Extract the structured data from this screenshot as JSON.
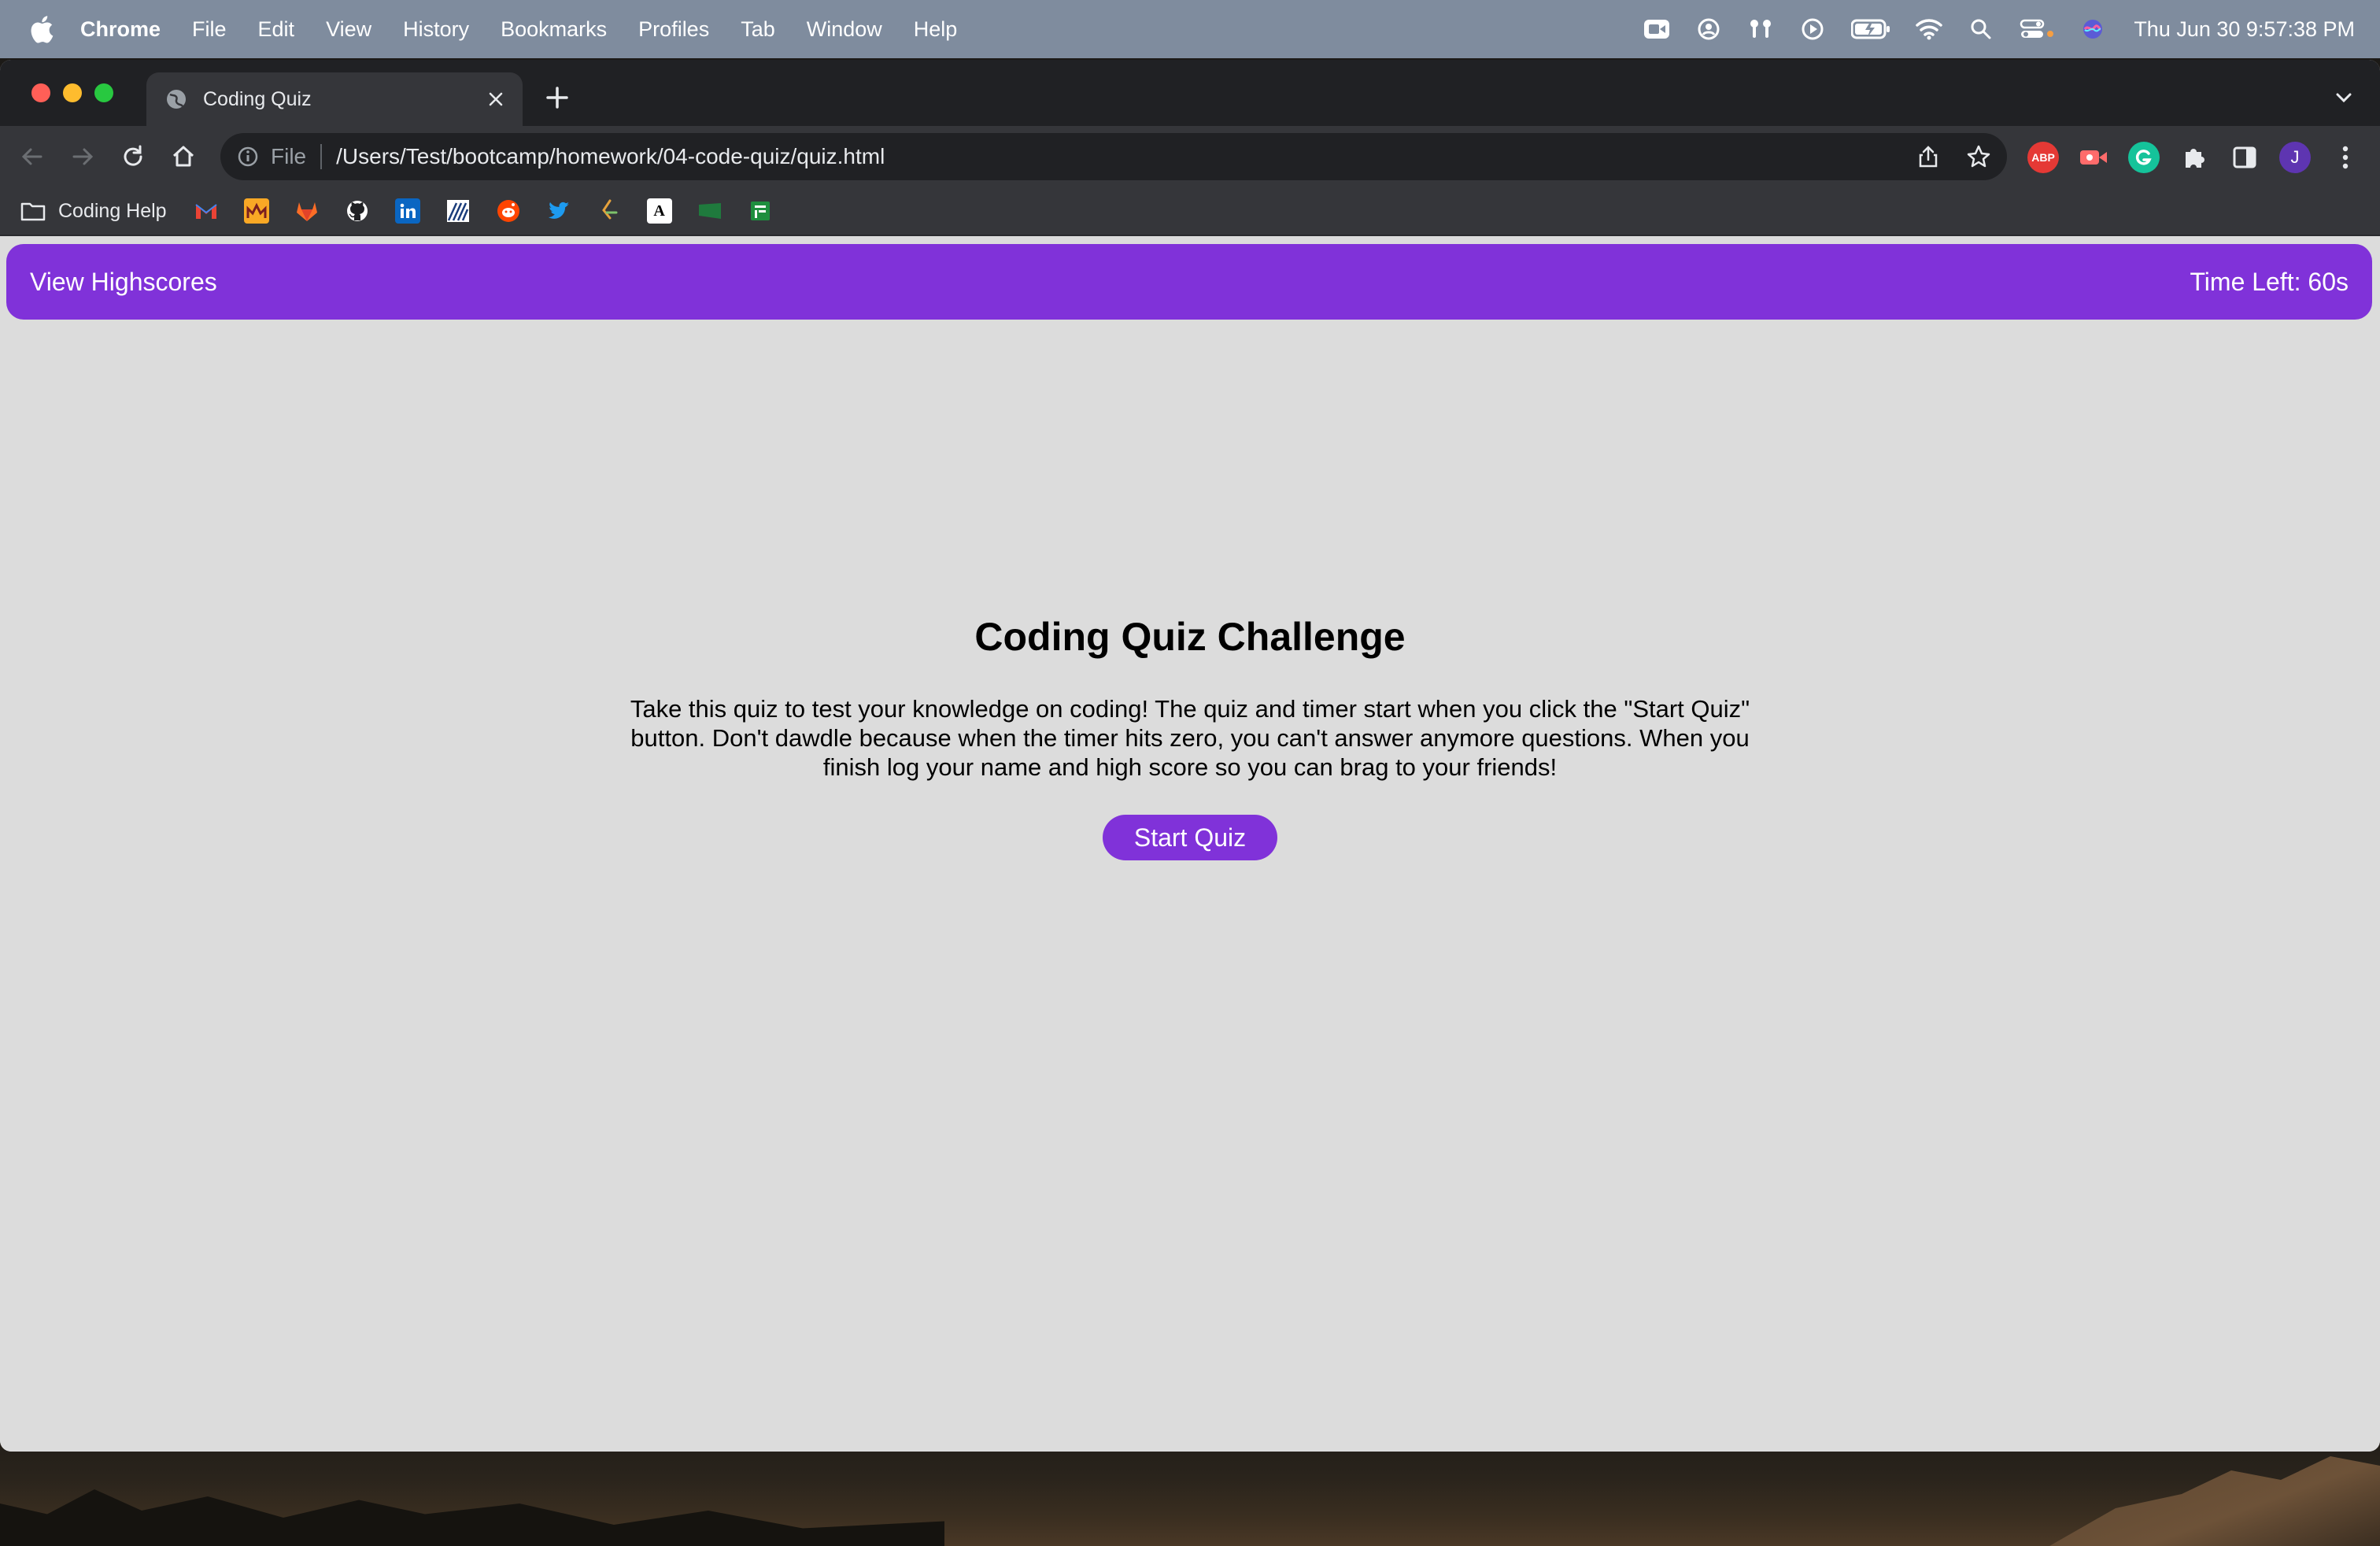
{
  "menubar": {
    "app_name": "Chrome",
    "items": [
      "File",
      "Edit",
      "View",
      "History",
      "Bookmarks",
      "Profiles",
      "Tab",
      "Window",
      "Help"
    ],
    "clock": "Thu Jun 30  9:57:38 PM",
    "status_icons": [
      "facetime-icon",
      "user-icon",
      "airpods-icon",
      "play-icon",
      "battery-icon",
      "wifi-icon",
      "spotlight-icon",
      "control-center-icon",
      "siri-icon"
    ]
  },
  "browser": {
    "tab_title": "Coding Quiz",
    "url_scheme": "File",
    "url": "/Users/Test/bootcamp/homework/04-code-quiz/quiz.html",
    "profile_initial": "J",
    "extensions": {
      "abp_label": "ABP"
    },
    "bookmarks": {
      "folder_label": "Coding Help",
      "favicons": [
        "gmail-icon",
        "moodle-icon",
        "gitlab-icon",
        "github-icon",
        "linkedin-icon",
        "bootcamp-icon",
        "reddit-icon",
        "twitter-icon",
        "leetcode-icon",
        "a-icon",
        "folder-green-icon",
        "sheets-icon"
      ],
      "a_label": "A"
    }
  },
  "page": {
    "header": {
      "highscores_link": "View Highscores",
      "timer": "Time Left: 60s"
    },
    "title": "Coding Quiz Challenge",
    "description": "Take this quiz to test your knowledge on coding! The quiz and timer start when you click the \"Start Quiz\" button. Don't dawdle because when the timer hits zero, you can't answer anymore questions. When you finish log your name and high score so you can brag to your friends!",
    "start_button": "Start Quiz"
  },
  "colors": {
    "accent": "#8032d9",
    "page_bg": "#dcdcdc",
    "menubar_bg": "#7f8c9e"
  }
}
